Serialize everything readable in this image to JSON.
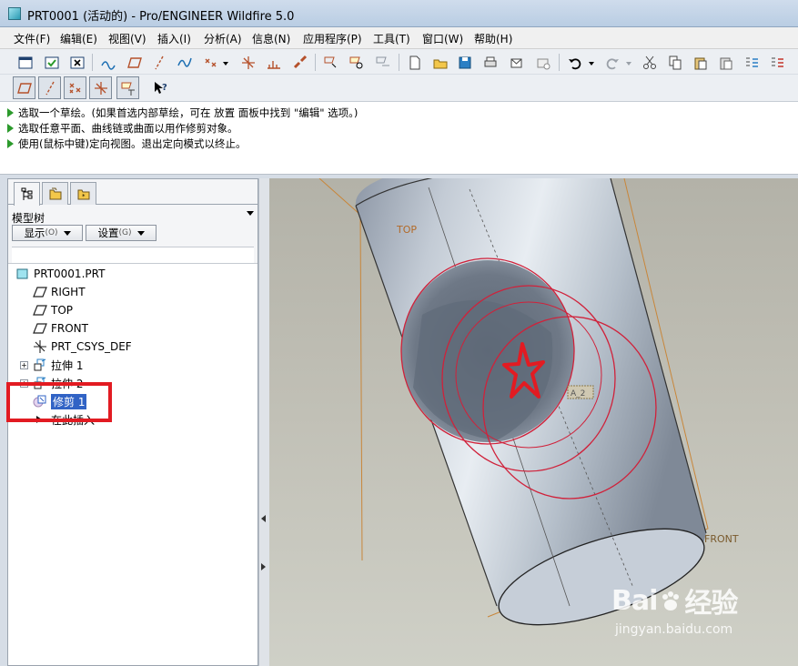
{
  "window": {
    "title": "PRT0001 (活动的) - Pro/ENGINEER Wildfire 5.0"
  },
  "menu": [
    {
      "label": "文件(F)"
    },
    {
      "label": "编辑(E)"
    },
    {
      "label": "视图(V)"
    },
    {
      "label": "插入(I)"
    },
    {
      "label": "分析(A)"
    },
    {
      "label": "信息(N)"
    },
    {
      "label": "应用程序(P)"
    },
    {
      "label": "工具(T)"
    },
    {
      "label": "窗口(W)"
    },
    {
      "label": "帮助(H)"
    }
  ],
  "messages": [
    "选取一个草绘。(如果首选内部草绘，可在 放置 面板中找到 \"编辑\" 选项。)",
    "选取任意平面、曲线链或曲面以用作修剪对象。",
    "使用(鼠标中键)定向视图。退出定向模式以终止。"
  ],
  "panel": {
    "title": "模型树",
    "show_label": "显示",
    "show_shortcut": "(O)",
    "settings_label": "设置",
    "settings_shortcut": "(G)"
  },
  "tree": [
    {
      "label": "PRT0001.PRT",
      "icon": "part-icon"
    },
    {
      "label": "RIGHT",
      "icon": "datum-plane-icon"
    },
    {
      "label": "TOP",
      "icon": "datum-plane-icon"
    },
    {
      "label": "FRONT",
      "icon": "datum-plane-icon"
    },
    {
      "label": "PRT_CSYS_DEF",
      "icon": "csys-icon"
    },
    {
      "label": "拉伸 1",
      "icon": "extrude-icon"
    },
    {
      "label": "拉伸 2",
      "icon": "extrude-icon"
    },
    {
      "label": "修剪 1",
      "icon": "trim-icon",
      "selected": true
    },
    {
      "label": "在此插入",
      "icon": "insert-here-icon"
    }
  ],
  "viewport": {
    "label_top": "TOP",
    "label_front": "FRONT",
    "label_csys": "A_2"
  },
  "watermark": {
    "logo": "Bai",
    "logo_suffix": "经验",
    "url": "jingyan.baidu.com"
  },
  "colors": {
    "highlight": "#e21b22",
    "selection": "#3163c5",
    "datum": "#c8863a",
    "edge_red": "#d0213a"
  }
}
